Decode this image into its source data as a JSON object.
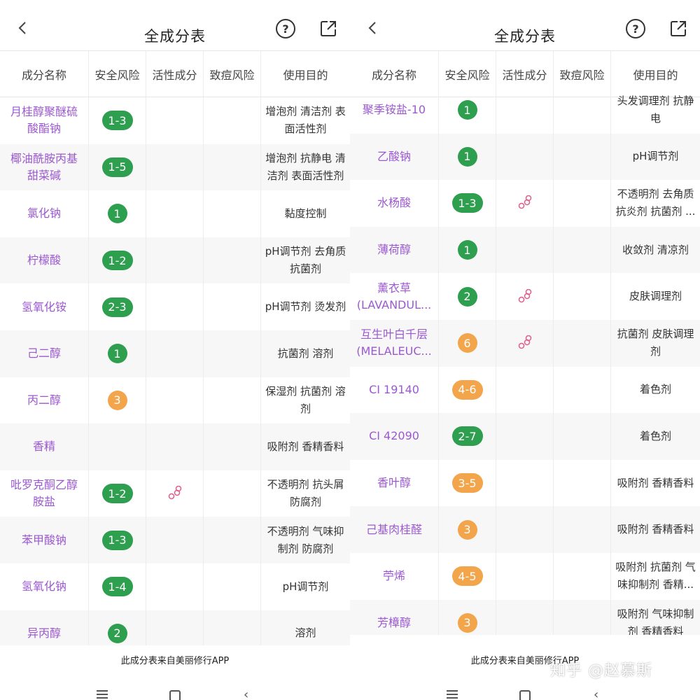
{
  "title": "全成分表",
  "help_symbol": "?",
  "columns": [
    "成分名称",
    "安全风险",
    "活性成分",
    "致痘风险",
    "使用目的"
  ],
  "footer_text": "此成分表来自美丽修行APP",
  "watermark": "知乎 @赵慕斯",
  "colors": {
    "name": "#9b59d0",
    "green": "#2e9e4f",
    "orange": "#f2a54a",
    "active_icon": "#e45a8a"
  },
  "left": {
    "rows": [
      {
        "name": "月桂醇聚醚硫酸酯钠",
        "risk": "1-3",
        "risk_color": "green",
        "active": false,
        "purpose": "增泡剂 清洁剂 表面活性剂"
      },
      {
        "name": "椰油酰胺丙基甜菜碱",
        "risk": "1-5",
        "risk_color": "green",
        "active": false,
        "purpose": "增泡剂 抗静电 清洁剂 表面活性剂"
      },
      {
        "name": "氯化钠",
        "risk": "1",
        "risk_color": "green",
        "active": false,
        "purpose": "黏度控制"
      },
      {
        "name": "柠檬酸",
        "risk": "1-2",
        "risk_color": "green",
        "active": false,
        "purpose": "pH调节剂 去角质 抗菌剂"
      },
      {
        "name": "氢氧化铵",
        "risk": "2-3",
        "risk_color": "green",
        "active": false,
        "purpose": "pH调节剂 烫发剂"
      },
      {
        "name": "己二醇",
        "risk": "1",
        "risk_color": "green",
        "active": false,
        "purpose": "抗菌剂 溶剂"
      },
      {
        "name": "丙二醇",
        "risk": "3",
        "risk_color": "orange",
        "active": false,
        "purpose": "保湿剂 抗菌剂 溶剂"
      },
      {
        "name": "香精",
        "risk": "",
        "risk_color": "",
        "active": false,
        "purpose": "吸附剂 香精香料"
      },
      {
        "name": "吡罗克酮乙醇胺盐",
        "risk": "1-2",
        "risk_color": "green",
        "active": true,
        "purpose": "不透明剂 抗头屑 防腐剂"
      },
      {
        "name": "苯甲酸钠",
        "risk": "1-3",
        "risk_color": "green",
        "active": false,
        "purpose": "不透明剂 气味抑制剂 防腐剂"
      },
      {
        "name": "氢氧化钠",
        "risk": "1-4",
        "risk_color": "green",
        "active": false,
        "purpose": "pH调节剂"
      },
      {
        "name": "异丙醇",
        "risk": "2",
        "risk_color": "green",
        "active": false,
        "purpose": "溶剂"
      }
    ]
  },
  "right": {
    "rows": [
      {
        "name": "聚季铵盐-10",
        "risk": "1",
        "risk_color": "green",
        "active": false,
        "purpose": "头发调理剂 抗静电"
      },
      {
        "name": "乙酸钠",
        "risk": "1",
        "risk_color": "green",
        "active": false,
        "purpose": "pH调节剂"
      },
      {
        "name": "水杨酸",
        "risk": "1-3",
        "risk_color": "green",
        "active": true,
        "purpose": "不透明剂 去角质 抗炎剂 抗菌剂 ..."
      },
      {
        "name": "薄荷醇",
        "risk": "1",
        "risk_color": "green",
        "active": false,
        "purpose": "收敛剂 清凉剂"
      },
      {
        "name": "薰衣草 (LAVANDUL...",
        "risk": "2",
        "risk_color": "green",
        "active": true,
        "purpose": "皮肤调理剂"
      },
      {
        "name": "互生叶白千层 (MELALEUC...",
        "risk": "6",
        "risk_color": "orange",
        "active": true,
        "purpose": "抗菌剂 皮肤调理剂"
      },
      {
        "name": "CI 19140",
        "risk": "4-6",
        "risk_color": "orange",
        "active": false,
        "purpose": "着色剂"
      },
      {
        "name": "CI 42090",
        "risk": "2-7",
        "risk_color": "green",
        "active": false,
        "purpose": "着色剂"
      },
      {
        "name": "香叶醇",
        "risk": "3-5",
        "risk_color": "orange",
        "active": false,
        "purpose": "吸附剂 香精香料"
      },
      {
        "name": "己基肉桂醛",
        "risk": "3",
        "risk_color": "orange",
        "active": false,
        "purpose": "吸附剂 香精香料"
      },
      {
        "name": "苧烯",
        "risk": "4-5",
        "risk_color": "orange",
        "active": false,
        "purpose": "吸附剂 抗菌剂 气味抑制剂 香精..."
      },
      {
        "name": "芳樟醇",
        "risk": "3",
        "risk_color": "orange",
        "active": false,
        "purpose": "吸附剂 气味抑制剂 香精香料"
      }
    ]
  }
}
